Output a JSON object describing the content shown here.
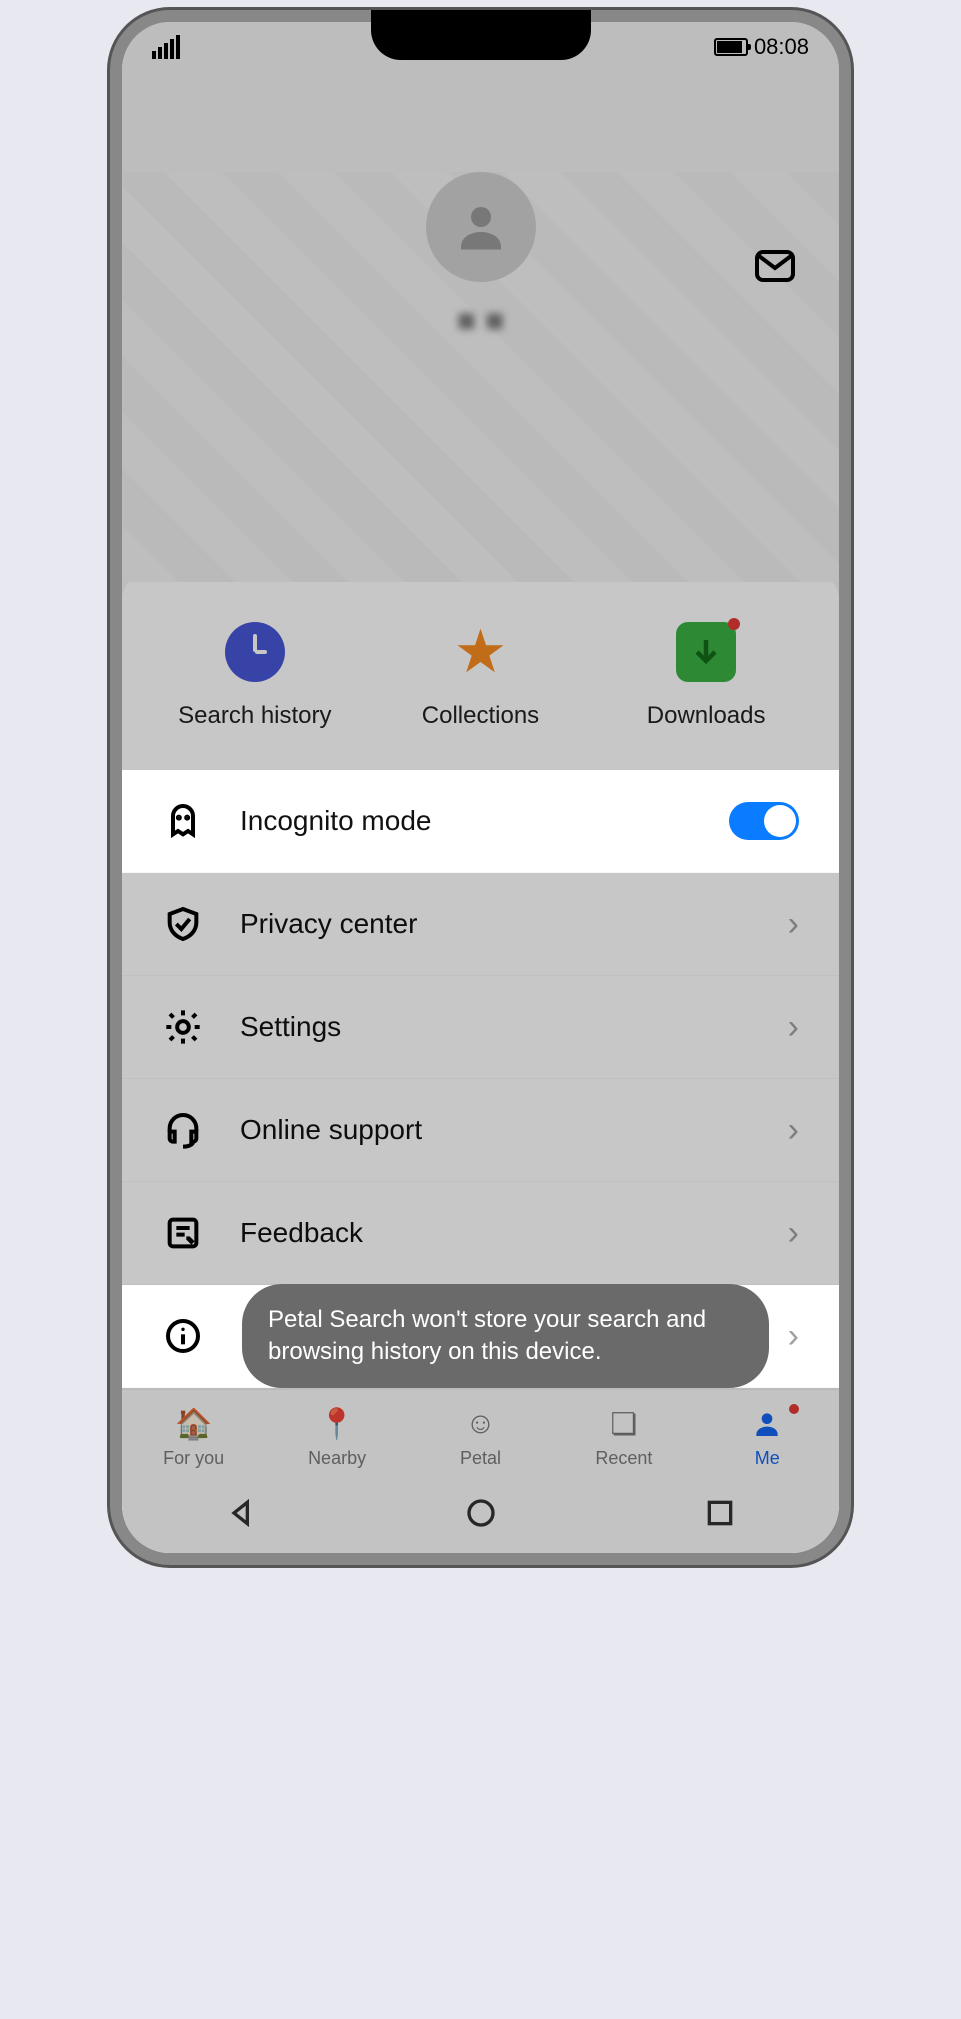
{
  "status": {
    "time": "08:08"
  },
  "profile": {
    "username": "■ ■"
  },
  "quick": {
    "history": "Search history",
    "collections": "Collections",
    "downloads": "Downloads"
  },
  "rows": {
    "incognito": "Incognito mode",
    "privacy": "Privacy center",
    "settings": "Settings",
    "support": "Online support",
    "feedback": "Feedback"
  },
  "toast": "Petal Search won't store your search and browsing history on this device.",
  "tabs": {
    "foryou": "For you",
    "nearby": "Nearby",
    "petal": "Petal",
    "recent": "Recent",
    "me": "Me"
  }
}
